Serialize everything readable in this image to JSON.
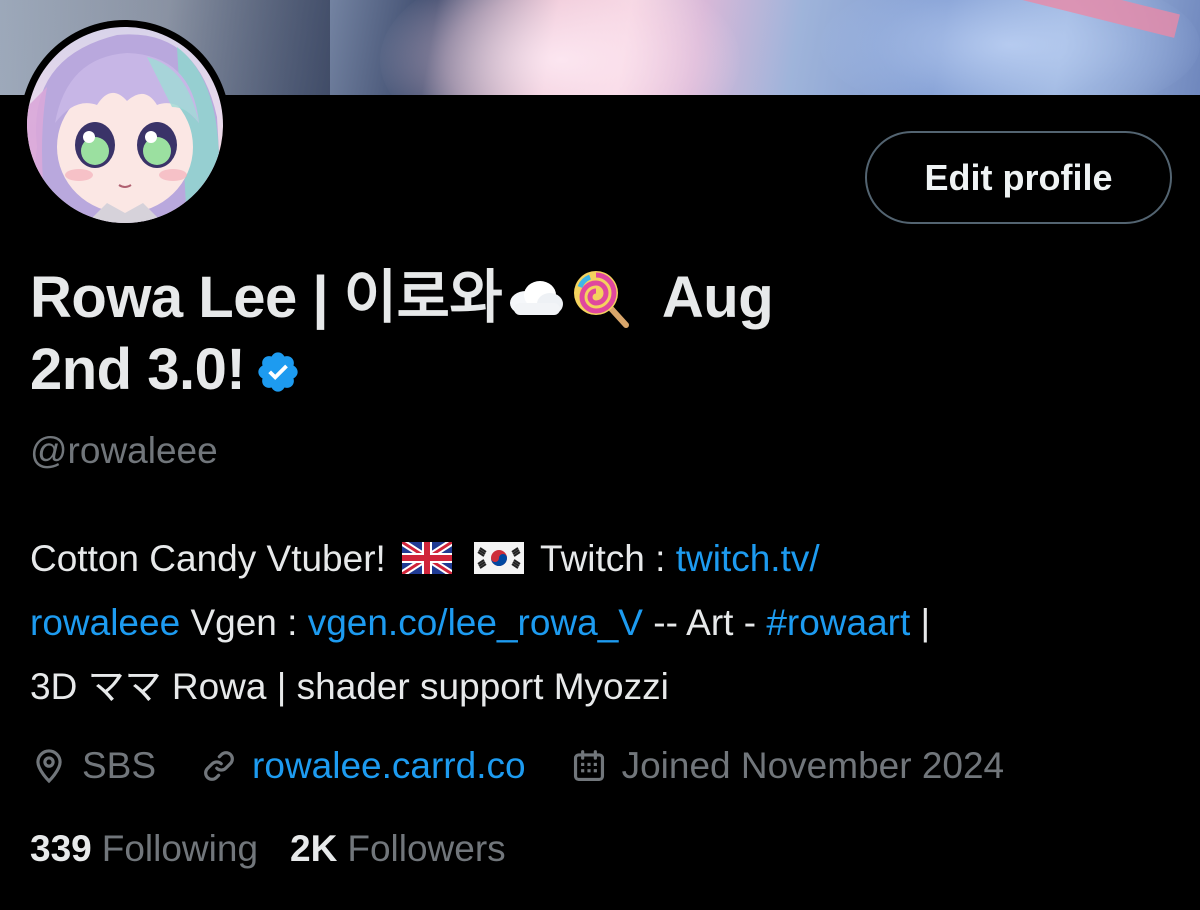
{
  "profile": {
    "name_line1": "Rowa Lee | 이로와",
    "name_emoji1": "cloud-emoji",
    "name_emoji2": "lollipop-emoji",
    "name_line1_tail": "Aug",
    "name_line2": "2nd 3.0!",
    "verified": true,
    "handle": "@rowaleee",
    "edit_button_label": "Edit profile"
  },
  "bio": {
    "text1": "Cotton Candy Vtuber!",
    "flag1": "uk-flag",
    "flag2": "south-korea-flag",
    "text2": "Twitch :",
    "link1_part1": "twitch.tv/",
    "link1_part2": "rowaleee",
    "text3": "Vgen :",
    "link2": "vgen.co/lee_rowa_V",
    "text4": "-- Art -",
    "hashtag": "#rowaart",
    "text5": "|",
    "text6": "3D ママ Rowa | shader support Myozzi"
  },
  "meta": {
    "location": "SBS",
    "website": "rowalee.carrd.co",
    "joined": "Joined November 2024"
  },
  "stats": {
    "following_count": "339",
    "following_label": "Following",
    "followers_count": "2K",
    "followers_label": "Followers"
  },
  "colors": {
    "background": "#000000",
    "text": "#e7e9ea",
    "muted": "#71767b",
    "link": "#1d9bf0",
    "verified": "#1d9bf0",
    "button_border": "#536471"
  }
}
